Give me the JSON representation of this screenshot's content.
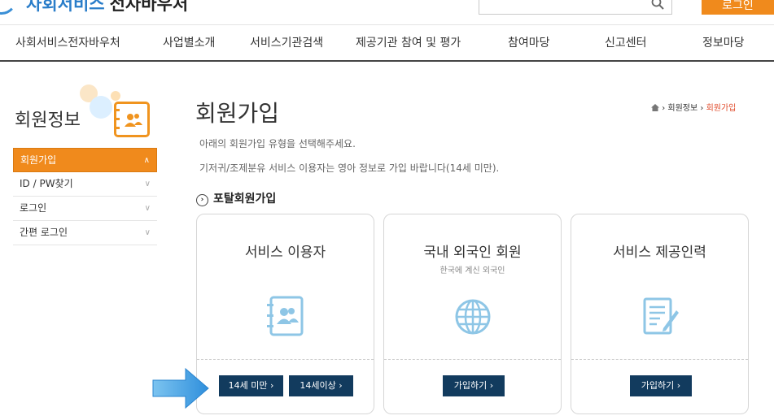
{
  "header": {
    "logo_blue": "사회서비스",
    "logo_dark": "전자바우처",
    "login_label": "로그인"
  },
  "nav": [
    "사회서비스전자바우처",
    "사업별소개",
    "서비스기관검색",
    "제공기관 참여 및 평가",
    "참여마당",
    "신고센터",
    "정보마당"
  ],
  "sidebar": {
    "title": "회원정보",
    "items": [
      {
        "label": "회원가입",
        "active": true
      },
      {
        "label": "ID / PW찾기"
      },
      {
        "label": "로그인"
      },
      {
        "label": "간편 로그인"
      }
    ]
  },
  "main": {
    "title": "회원가입",
    "breadcrumb": [
      "회원정보",
      "회원가입"
    ],
    "desc1": "아래의 회원가입 유형을 선택해주세요.",
    "desc2": "기저귀/조제분유 서비스 이용자는 영아 정보로 가입 바랍니다(14세 미만).",
    "section_title": "포탈회원가입",
    "cards": [
      {
        "title": "서비스 이용자",
        "subtitle": "",
        "icon": "contacts-book-icon",
        "buttons": [
          "14세 미만 ›",
          "14세이상 ›"
        ]
      },
      {
        "title": "국내 외국인 회원",
        "subtitle": "한국에 계신 외국인",
        "icon": "globe-icon",
        "buttons": [
          "가입하기 ›"
        ]
      },
      {
        "title": "서비스 제공인력",
        "subtitle": "",
        "icon": "document-edit-icon",
        "buttons": [
          "가입하기 ›"
        ]
      }
    ]
  },
  "colors": {
    "accent_orange": "#f08a1c",
    "button_navy": "#123b5e",
    "icon_blue": "#8ec6e6",
    "arrow_blue": "#3a9be0",
    "breadcrumb_current": "#e04b2b"
  }
}
